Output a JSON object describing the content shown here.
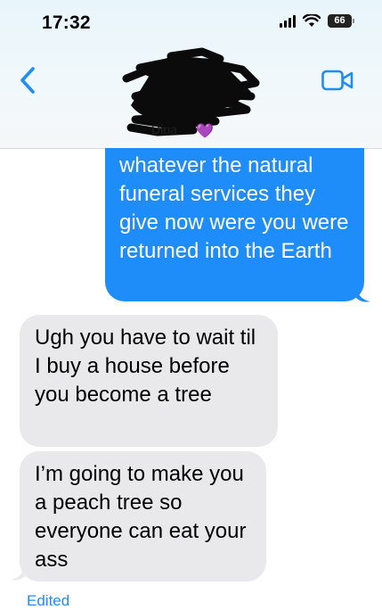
{
  "status_bar": {
    "time": "17:32",
    "battery": "66"
  },
  "header": {
    "contact_name": "Dina",
    "heart_emoji": "💜",
    "icons": [
      "chevron-left-icon",
      "video-camera-icon"
    ]
  },
  "messages": [
    {
      "direction": "sent",
      "text": "whatever the natural funeral services they give now were you were returned into the Earth"
    },
    {
      "direction": "received",
      "text": "Ugh you have to wait til I buy a house before you become a tree"
    },
    {
      "direction": "received",
      "text": "I’m going to make you a peach tree so everyone can eat your ass"
    }
  ],
  "edited_label": "Edited",
  "colors": {
    "sent_bubble": "#1e8df9",
    "received_bubble": "#e9e9eb",
    "accent": "#1e8df9"
  }
}
